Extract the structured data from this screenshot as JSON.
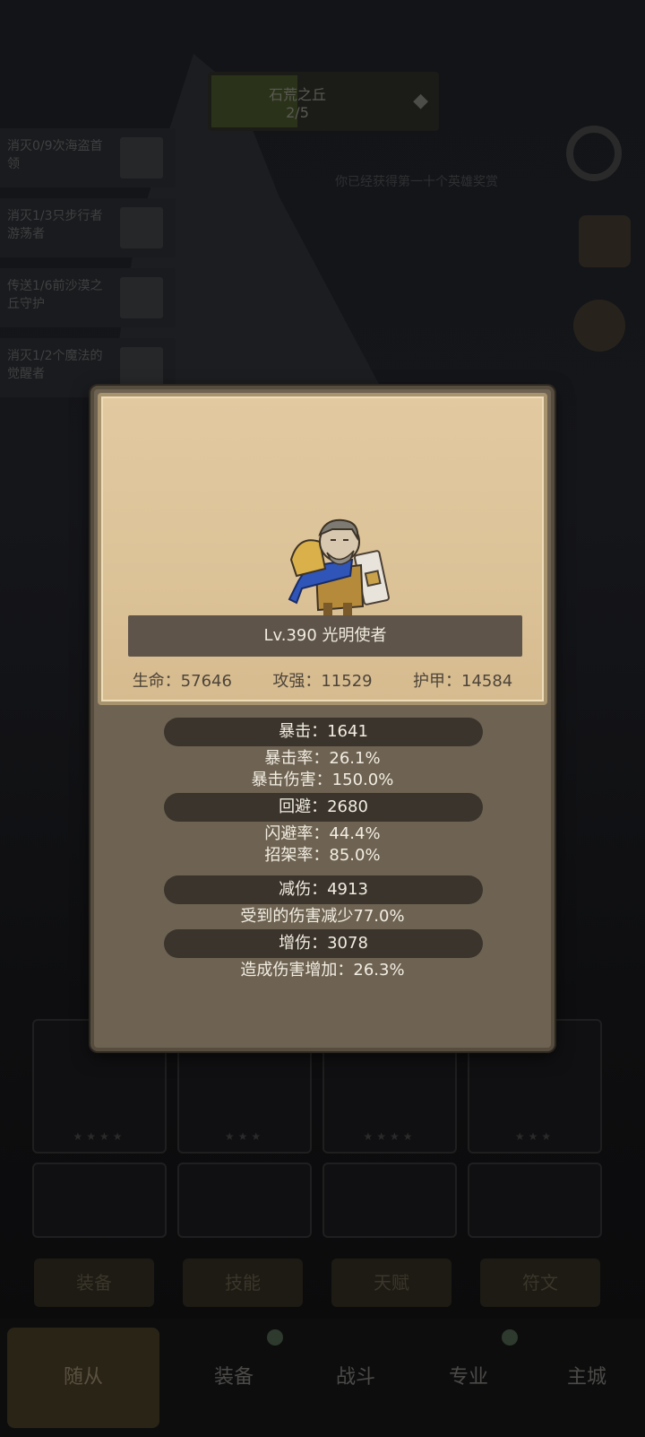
{
  "background": {
    "stage": {
      "name": "石荒之丘",
      "progress": "2/5"
    },
    "quests": [
      "消灭0/9次海盗首领",
      "消灭1/3只步行者游荡者",
      "传送1/6前沙漠之丘守护",
      "消灭1/2个魔法的觉醒者"
    ],
    "notice": "你已经获得第一十个英雄奖赏",
    "sub_tabs": [
      "装备",
      "技能",
      "天赋",
      "符文"
    ],
    "nav": [
      "随从",
      "装备",
      "战斗",
      "专业",
      "主城"
    ]
  },
  "hero": {
    "name": "Lv.390 光明使者",
    "life": "生命：57646",
    "attack": "攻强：11529",
    "armor": "护甲：14584"
  },
  "details": {
    "crit": "暴击：1641",
    "crit_rate": "暴击率：26.1%",
    "crit_damage": "暴击伤害：150.0%",
    "dodge": "回避：2680",
    "dodge_rate": "闪避率：44.4%",
    "parry_rate": "招架率：85.0%",
    "damage_reduction": "减伤：4913",
    "damage_taken": "受到的伤害减少77.0%",
    "damage_increase": "增伤：3078",
    "damage_dealt": "造成伤害增加：26.3%"
  },
  "colors": {
    "parchment": "#e2c9a0",
    "panel": "#6e6352",
    "pill": "#3a342c"
  }
}
